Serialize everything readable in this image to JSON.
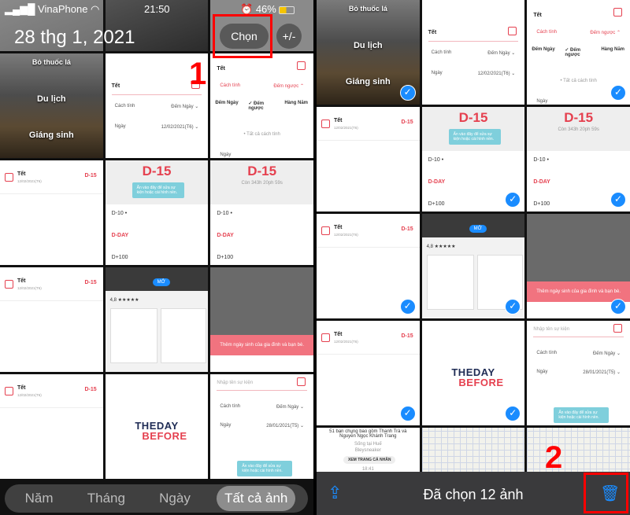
{
  "status": {
    "carrier": "VinaPhone",
    "time": "21:50",
    "battery": "46%"
  },
  "header": {
    "date": "28 thg 1, 2021",
    "select_label": "Chọn",
    "plusminus_label": "+/-"
  },
  "annotations": {
    "step1": "1",
    "step2": "2",
    "highlight_color": "#ff0000"
  },
  "tabs": [
    {
      "label": "Năm"
    },
    {
      "label": "Tháng"
    },
    {
      "label": "Ngày"
    },
    {
      "label": "Tất cả ảnh",
      "active": true
    }
  ],
  "toolbar": {
    "title": "Đã chọn 12 ảnh",
    "share_icon": "share-icon",
    "trash_icon": "trash-icon"
  },
  "accent": "#1a8cff",
  "texts": {
    "album": [
      "Bỏ thuốc lá",
      "Du lịch",
      "Giáng sinh"
    ],
    "tet": "Tết",
    "cachtinh": "Cách tính",
    "demngay": "Đếm Ngày",
    "ngay": "Ngày",
    "date1": "12/02/2021(T6)",
    "demnguoc": "Đếm ngược",
    "demnguoc2": "Đếm ngược",
    "hangnam": "Hàng Năm",
    "tatca": "• Tất cả cách tính",
    "d15": "D-15",
    "con": "Còn 343h 20ph 59s",
    "tip": "Ấn vào đây để sửa sự kiện hoặc cài hình nền.",
    "d10": "D-10",
    "dday": "D-DAY",
    "d100": "D+100",
    "bday": "Thêm ngày sinh của gia đình và bạn bè.",
    "nhap": "Nhập tên sự kiện",
    "date2": "28/01/2021(T5)",
    "logo1": "THEDAY",
    "logo2": "BEFORE",
    "rating": "4,8 ★★★★★",
    "mo": "MỞ",
    "fb1": "51 bạn chung bao gồm Thanh Trà và Nguyễn Ngọc Khánh Trang",
    "fb2": "Sống tại Huế",
    "fb3": "Bleysneaker",
    "fb4": "XEM TRANG CÁ NHÂN",
    "fb5": "18:41"
  },
  "left_grid": [
    {
      "type": "photo-doc"
    },
    {
      "type": "photo-dark"
    },
    {
      "type": "photo-grey"
    },
    {
      "type": "album"
    },
    {
      "type": "form1"
    },
    {
      "type": "form2"
    },
    {
      "type": "list"
    },
    {
      "type": "d15tip"
    },
    {
      "type": "d15con"
    },
    {
      "type": "list"
    },
    {
      "type": "appstore"
    },
    {
      "type": "bday"
    },
    {
      "type": "list"
    },
    {
      "type": "logo"
    },
    {
      "type": "form3"
    }
  ],
  "right_grid": [
    {
      "type": "album",
      "checked": true
    },
    {
      "type": "form1"
    },
    {
      "type": "form2",
      "checked": true
    },
    {
      "type": "list"
    },
    {
      "type": "d15tip",
      "checked": true
    },
    {
      "type": "d15con",
      "checked": true
    },
    {
      "type": "list",
      "checked": true
    },
    {
      "type": "appstore",
      "checked": true
    },
    {
      "type": "bday",
      "checked": true
    },
    {
      "type": "list",
      "checked": true
    },
    {
      "type": "logo",
      "checked": true
    },
    {
      "type": "form3"
    },
    {
      "type": "fb"
    },
    {
      "type": "notes"
    },
    {
      "type": "notes"
    }
  ]
}
